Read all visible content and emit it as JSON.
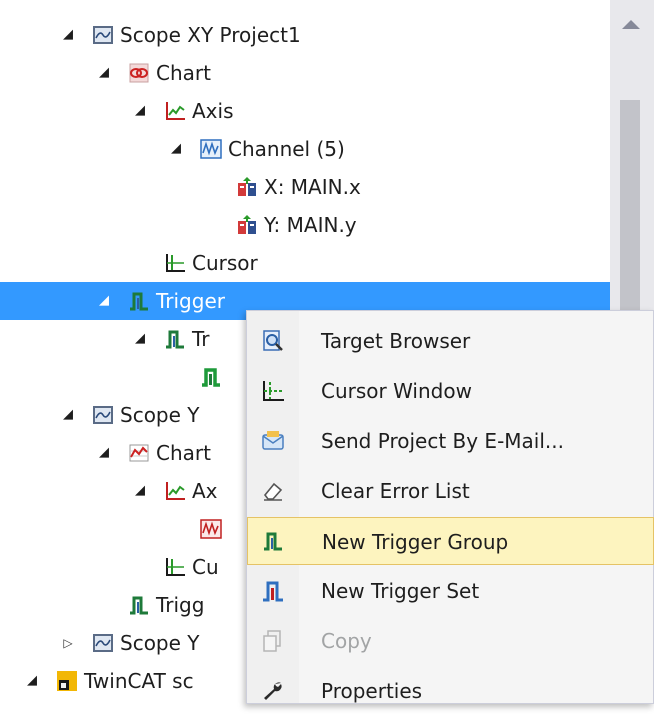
{
  "tree": {
    "items": [
      {
        "label": "Scope XY Project1",
        "icon": "scope-project-icon",
        "state": "expanded"
      },
      {
        "label": "Chart",
        "icon": "xy-chart-icon",
        "state": "expanded"
      },
      {
        "label": "Axis",
        "icon": "axis-icon",
        "state": "expanded"
      },
      {
        "label": "Channel (5)",
        "icon": "channel-icon",
        "state": "expanded"
      },
      {
        "label": "X: MAIN.x",
        "icon": "symbol-icon",
        "state": "leaf"
      },
      {
        "label": "Y: MAIN.y",
        "icon": "symbol-icon",
        "state": "leaf"
      },
      {
        "label": "Cursor",
        "icon": "cursor-icon",
        "state": "leaf"
      },
      {
        "label": "Trigger",
        "icon": "trigger-icon",
        "state": "expanded",
        "selected": true
      },
      {
        "label": "Tr",
        "icon": "trigger-group-icon",
        "state": "expanded"
      },
      {
        "label": "",
        "icon": "trigger-set-icon",
        "state": "leaf"
      },
      {
        "label": "Scope Y",
        "icon": "scope-project-icon",
        "state": "expanded"
      },
      {
        "label": "Chart",
        "icon": "yt-chart-icon",
        "state": "expanded"
      },
      {
        "label": "Ax",
        "icon": "axis-icon",
        "state": "expanded"
      },
      {
        "label": "",
        "icon": "channel-red-icon",
        "state": "leaf"
      },
      {
        "label": "Cu",
        "icon": "cursor-icon",
        "state": "leaf"
      },
      {
        "label": "Trigg",
        "icon": "trigger-icon",
        "state": "leaf"
      },
      {
        "label": "Scope Y",
        "icon": "scope-project-icon",
        "state": "collapsed"
      },
      {
        "label": "TwinCAT sc",
        "icon": "twincat-solution-icon",
        "state": "expanded"
      }
    ]
  },
  "context_menu": {
    "items": [
      {
        "label": "Target Browser",
        "icon": "target-browser-icon",
        "enabled": true
      },
      {
        "label": "Cursor Window",
        "icon": "cursor-window-icon",
        "enabled": true
      },
      {
        "label": "Send Project By E-Mail...",
        "icon": "email-icon",
        "enabled": true
      },
      {
        "label": "Clear Error List",
        "icon": "eraser-icon",
        "enabled": true
      },
      {
        "label": "New Trigger Group",
        "icon": "trigger-group-icon",
        "enabled": true,
        "highlighted": true
      },
      {
        "label": "New Trigger Set",
        "icon": "trigger-set-icon",
        "enabled": true
      },
      {
        "label": "Copy",
        "icon": "copy-icon",
        "enabled": false
      },
      {
        "label": "Properties",
        "icon": "wrench-icon",
        "enabled": true
      }
    ]
  },
  "colors": {
    "selection": "#3399ff",
    "menu_highlight": "#fdf4bf",
    "menu_highlight_border": "#e5c365",
    "scrollbar_track": "#e8e8ec",
    "scrollbar_thumb": "#c2c3c9"
  }
}
